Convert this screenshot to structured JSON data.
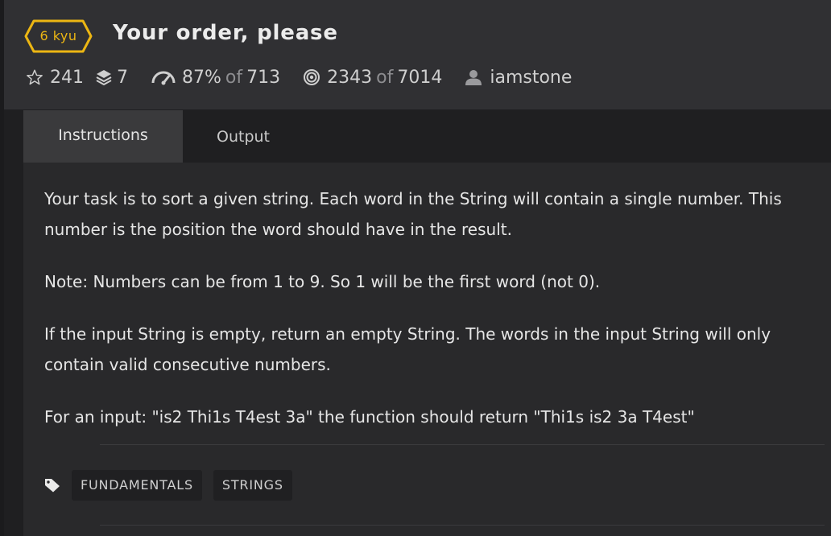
{
  "kata": {
    "rank": "6 kyu",
    "title": "Your order, please"
  },
  "stats": {
    "stars": "241",
    "collections": "7",
    "satisfaction_percent": "87%",
    "of_label": "of",
    "satisfaction_votes": "713",
    "completed": "2343",
    "attempted": "7014",
    "author": "iamstone"
  },
  "tabs": [
    {
      "label": "Instructions",
      "active": true
    },
    {
      "label": "Output",
      "active": false
    }
  ],
  "description": {
    "paragraphs": [
      "Your task is to sort a given string. Each word in the String will contain a single number. This number is the position the word should have in the result.",
      "Note: Numbers can be from 1 to 9. So 1 will be the first word (not 0).",
      "If the input String is empty, return an empty String. The words in the input String will only contain valid consecutive numbers.",
      "For an input: \"is2 Thi1s T4est 3a\" the function should return \"Thi1s is2 3a T4est\""
    ]
  },
  "tags": [
    "FUNDAMENTALS",
    "STRINGS"
  ],
  "colors": {
    "rank_accent": "#ecb613",
    "header_bg": "#303033",
    "panel_bg": "#29292b"
  },
  "icons": [
    "star-icon",
    "layers-icon",
    "speedometer-icon",
    "target-icon",
    "user-icon",
    "tag-icon"
  ]
}
